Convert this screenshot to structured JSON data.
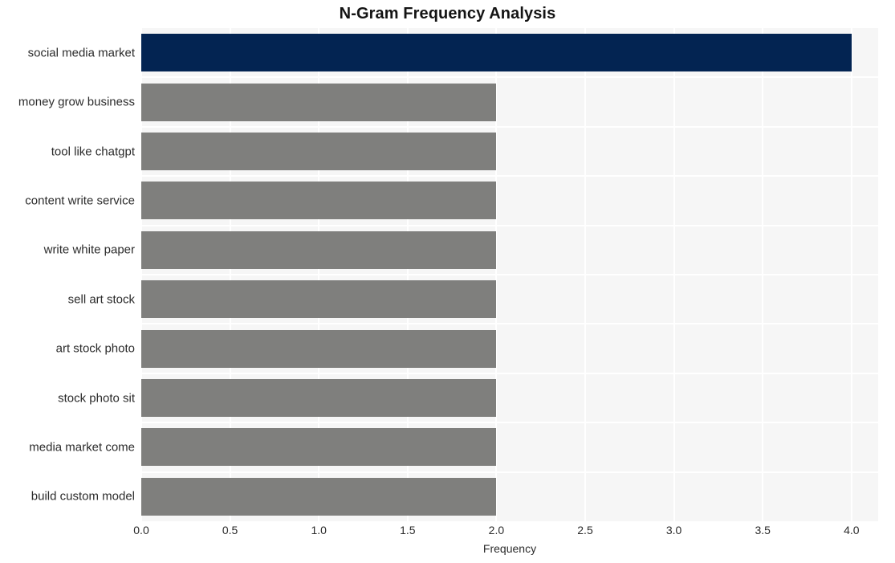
{
  "chart_data": {
    "type": "bar",
    "orientation": "horizontal",
    "title": "N-Gram Frequency Analysis",
    "xlabel": "Frequency",
    "ylabel": "",
    "categories": [
      "social media market",
      "money grow business",
      "tool like chatgpt",
      "content write service",
      "write white paper",
      "sell art stock",
      "art stock photo",
      "stock photo sit",
      "media market come",
      "build custom model"
    ],
    "values": [
      4,
      2,
      2,
      2,
      2,
      2,
      2,
      2,
      2,
      2
    ],
    "xlim": [
      0,
      4.15
    ],
    "xticks": [
      0,
      0.5,
      1,
      1.5,
      2,
      2.5,
      3,
      3.5,
      4
    ],
    "xtick_labels": [
      "0.0",
      "0.5",
      "1.0",
      "1.5",
      "2.0",
      "2.5",
      "3.0",
      "3.5",
      "4.0"
    ],
    "grid": true,
    "legend": false,
    "bar_colors": [
      "#032452",
      "#7f7f7d",
      "#7f7f7d",
      "#7f7f7d",
      "#7f7f7d",
      "#7f7f7d",
      "#7f7f7d",
      "#7f7f7d",
      "#7f7f7d",
      "#7f7f7d"
    ],
    "highlight_color": "#032452",
    "default_bar_color": "#7f7f7d",
    "plot_background": "#f6f6f6",
    "gridline_color": "#ffffff",
    "figure_background": "#ffffff"
  }
}
